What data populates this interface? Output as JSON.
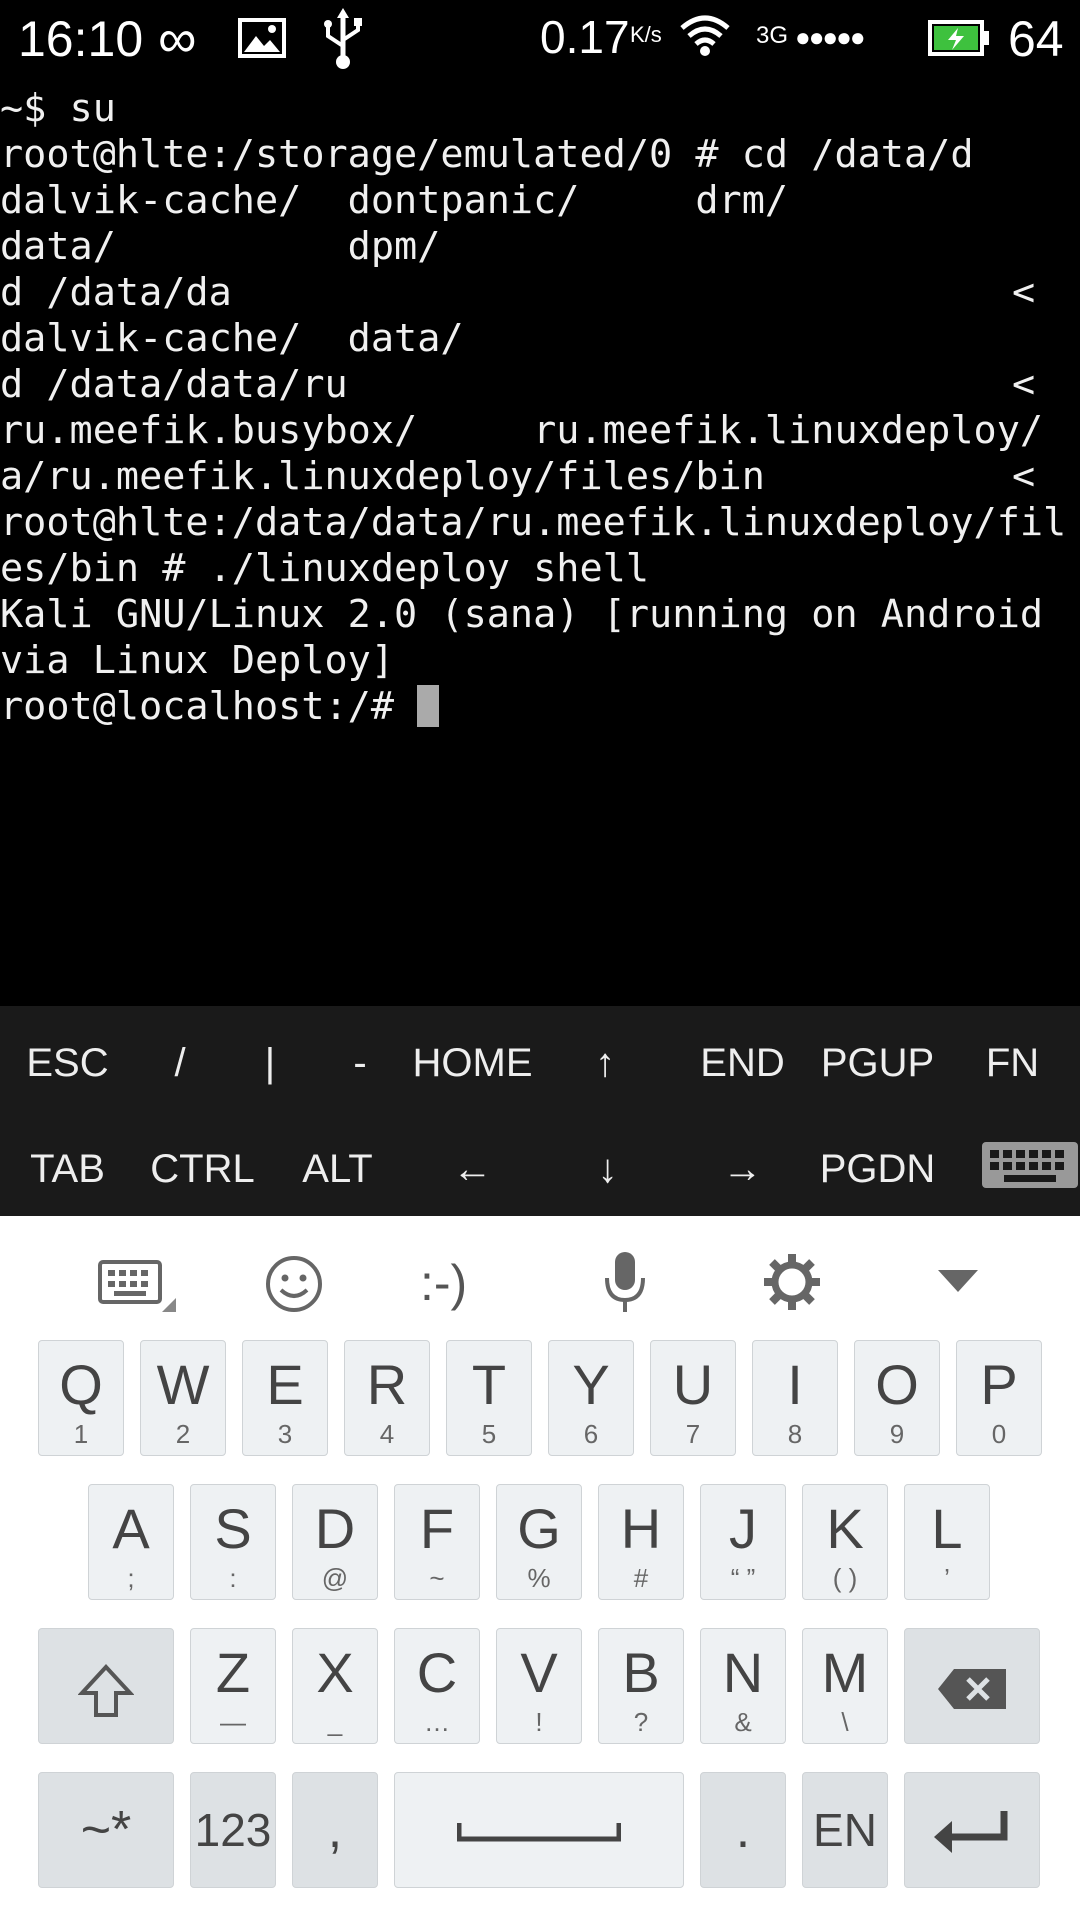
{
  "status_bar": {
    "time": "16:10",
    "speed": "0.17",
    "speed_unit": "K/s",
    "network": "3G",
    "signal_dots": "●●●●●",
    "battery_level": "64",
    "icons": [
      "infinity-icon",
      "image-icon",
      "usb-icon",
      "wifi-icon",
      "battery-charging-icon"
    ]
  },
  "terminal": {
    "lines": [
      "~$ su",
      "root@hlte:/storage/emulated/0 # cd /data/d",
      "dalvik-cache/  dontpanic/     drm/",
      "data/          dpm/",
      "d /data/da",
      "dalvik-cache/  data/",
      "d /data/data/ru",
      "ru.meefik.busybox/     ru.meefik.linuxdeploy/",
      "a/ru.meefik.linuxdeploy/files/bin",
      "root@hlte:/data/data/ru.meefik.linuxdeploy/fil",
      "es/bin # ./linuxdeploy shell",
      "Kali GNU/Linux 2.0 (sana) [running on Android",
      "via Linux Deploy]",
      "root@localhost:/# "
    ],
    "overflow_marker": "<"
  },
  "extra_keys": {
    "row1": [
      "ESC",
      "/",
      "|",
      "-",
      "HOME",
      "↑",
      "END",
      "PGUP",
      "FN"
    ],
    "row2": [
      "TAB",
      "CTRL",
      "ALT",
      "←",
      "↓",
      "→",
      "PGDN"
    ]
  },
  "keyboard": {
    "toolbar": {
      "emoticon": ":-)"
    },
    "row1": [
      {
        "main": "Q",
        "sub": "1"
      },
      {
        "main": "W",
        "sub": "2"
      },
      {
        "main": "E",
        "sub": "3"
      },
      {
        "main": "R",
        "sub": "4"
      },
      {
        "main": "T",
        "sub": "5"
      },
      {
        "main": "Y",
        "sub": "6"
      },
      {
        "main": "U",
        "sub": "7"
      },
      {
        "main": "I",
        "sub": "8"
      },
      {
        "main": "O",
        "sub": "9"
      },
      {
        "main": "P",
        "sub": "0"
      }
    ],
    "row2": [
      {
        "main": "A",
        "sub": ";"
      },
      {
        "main": "S",
        "sub": ":"
      },
      {
        "main": "D",
        "sub": "@"
      },
      {
        "main": "F",
        "sub": "~"
      },
      {
        "main": "G",
        "sub": "%"
      },
      {
        "main": "H",
        "sub": "#"
      },
      {
        "main": "J",
        "sub": "“ ”"
      },
      {
        "main": "K",
        "sub": "( )"
      },
      {
        "main": "L",
        "sub": "’"
      }
    ],
    "row3": [
      {
        "main": "Z",
        "sub": "—"
      },
      {
        "main": "X",
        "sub": "_"
      },
      {
        "main": "C",
        "sub": "…"
      },
      {
        "main": "V",
        "sub": "!"
      },
      {
        "main": "B",
        "sub": "?"
      },
      {
        "main": "N",
        "sub": "&"
      },
      {
        "main": "M",
        "sub": "\\"
      }
    ],
    "row4": {
      "symbols": "~*",
      "numbers": "123",
      "comma": ",",
      "period": ".",
      "language": "EN"
    }
  }
}
